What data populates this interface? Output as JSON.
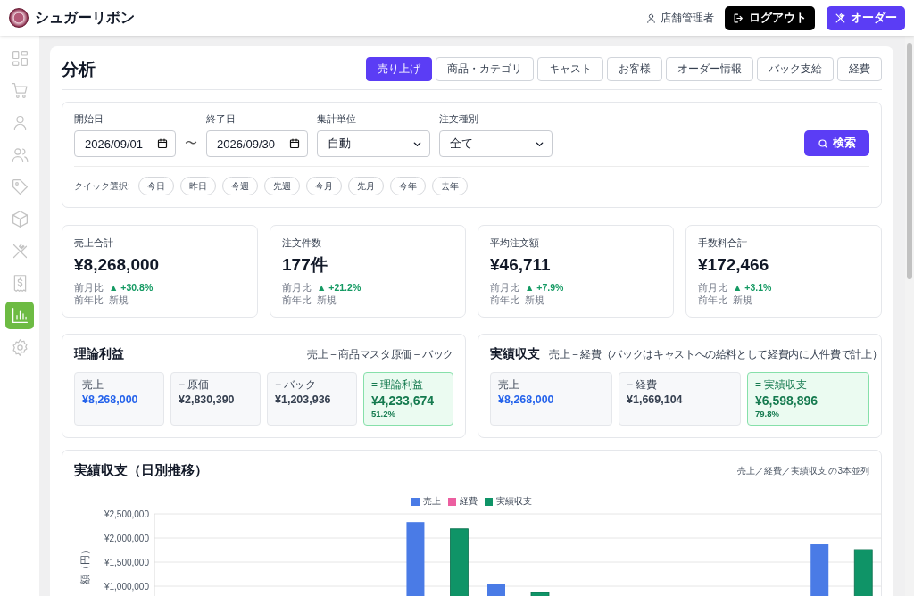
{
  "app": {
    "name": "シュガーリボン"
  },
  "header": {
    "user": "店舗管理者",
    "logout": "ログアウト",
    "order": "オーダー"
  },
  "sidebar": {
    "items": [
      {
        "kind": "grid",
        "selected": false
      },
      {
        "kind": "cart",
        "selected": false
      },
      {
        "kind": "user",
        "selected": false
      },
      {
        "kind": "users",
        "selected": false
      },
      {
        "kind": "tag",
        "selected": false
      },
      {
        "kind": "box",
        "selected": false
      },
      {
        "kind": "utensils",
        "selected": false
      },
      {
        "kind": "receipt",
        "selected": false
      },
      {
        "kind": "chart",
        "selected": true
      },
      {
        "kind": "gear",
        "selected": false
      }
    ]
  },
  "page": {
    "title": "分析",
    "tabs": [
      {
        "label": "売り上げ",
        "selected": true
      },
      {
        "label": "商品・カテゴリ",
        "selected": false
      },
      {
        "label": "キャスト",
        "selected": false
      },
      {
        "label": "お客様",
        "selected": false
      },
      {
        "label": "オーダー情報",
        "selected": false
      },
      {
        "label": "バック支給",
        "selected": false
      },
      {
        "label": "経費",
        "selected": false
      }
    ]
  },
  "filters": {
    "fields": [
      {
        "label": "開始日",
        "kind": "date",
        "value": "2026/09/01"
      },
      {
        "label": "終了日",
        "kind": "date",
        "value": "2026/09/30"
      },
      {
        "label": "集計単位",
        "kind": "select",
        "value": "自動"
      },
      {
        "label": "注文種別",
        "kind": "select",
        "value": "全て"
      }
    ],
    "separator": "〜",
    "search": "検索",
    "quick_label": "クイック選択:",
    "quick": [
      "今日",
      "昨日",
      "今週",
      "先週",
      "今月",
      "先月",
      "今年",
      "去年"
    ]
  },
  "kpis": [
    {
      "label": "売上合計",
      "value": "¥8,268,000",
      "mom_label": "前月比",
      "mom": "▲ +30.8%",
      "yoy_label": "前年比",
      "yoy": "新規"
    },
    {
      "label": "注文件数",
      "value": "177件",
      "mom_label": "前月比",
      "mom": "▲ +21.2%",
      "yoy_label": "前年比",
      "yoy": "新規"
    },
    {
      "label": "平均注文額",
      "value": "¥46,711",
      "mom_label": "前月比",
      "mom": "▲ +7.9%",
      "yoy_label": "前年比",
      "yoy": "新規"
    },
    {
      "label": "手数料合計",
      "value": "¥172,466",
      "mom_label": "前月比",
      "mom": "▲ +3.1%",
      "yoy_label": "前年比",
      "yoy": "新規"
    }
  ],
  "breakdowns": [
    {
      "title": "理論利益",
      "formula": "売上 − 商品マスタ原価 − バック",
      "items": [
        {
          "kind": "sales",
          "label": "売上",
          "value": "¥8,268,000"
        },
        {
          "kind": "cost",
          "label": "− 原価",
          "value": "¥2,830,390"
        },
        {
          "kind": "cost",
          "label": "− バック",
          "value": "¥1,203,936"
        },
        {
          "kind": "result",
          "label": "= 理論利益",
          "value": "¥4,233,674",
          "sub": "51.2%"
        }
      ]
    },
    {
      "title": "実績収支",
      "formula": "売上 − 経費（バックはキャストへの給料として経費内に人件費で計上）",
      "items": [
        {
          "kind": "sales",
          "label": "売上",
          "value": "¥8,268,000"
        },
        {
          "kind": "cost",
          "label": "− 経費",
          "value": "¥1,669,104"
        },
        {
          "kind": "result",
          "label": "= 実績収支",
          "value": "¥6,598,896",
          "sub": "79.8%"
        }
      ]
    }
  ],
  "daily": {
    "title": "実績収支（日別推移）",
    "note": "売上／経費／実績収支 の3本並列",
    "chart_data": {
      "type": "bar",
      "ylabel": "額（円）",
      "ylim": [
        0,
        2500000
      ],
      "grid": true,
      "legend": true,
      "yticks": [
        {
          "value": 1000000,
          "label": "¥1,000,000"
        },
        {
          "value": 1500000,
          "label": "¥1,500,000"
        },
        {
          "value": 2000000,
          "label": "¥2,000,000"
        },
        {
          "value": 2500000,
          "label": "¥2,500,000"
        }
      ],
      "series": [
        {
          "name": "売上",
          "color": "#4a7be6",
          "values": [
            null,
            null,
            null,
            2330000,
            1050000,
            null,
            null,
            null,
            1870000
          ]
        },
        {
          "name": "経費",
          "color": "#ec5fa0",
          "values": [
            null,
            null,
            null,
            null,
            null,
            null,
            null,
            null,
            null
          ]
        },
        {
          "name": "実績収支",
          "color": "#0f9467",
          "values": [
            null,
            null,
            null,
            2190000,
            870000,
            null,
            null,
            null,
            1760000
          ]
        }
      ]
    }
  }
}
